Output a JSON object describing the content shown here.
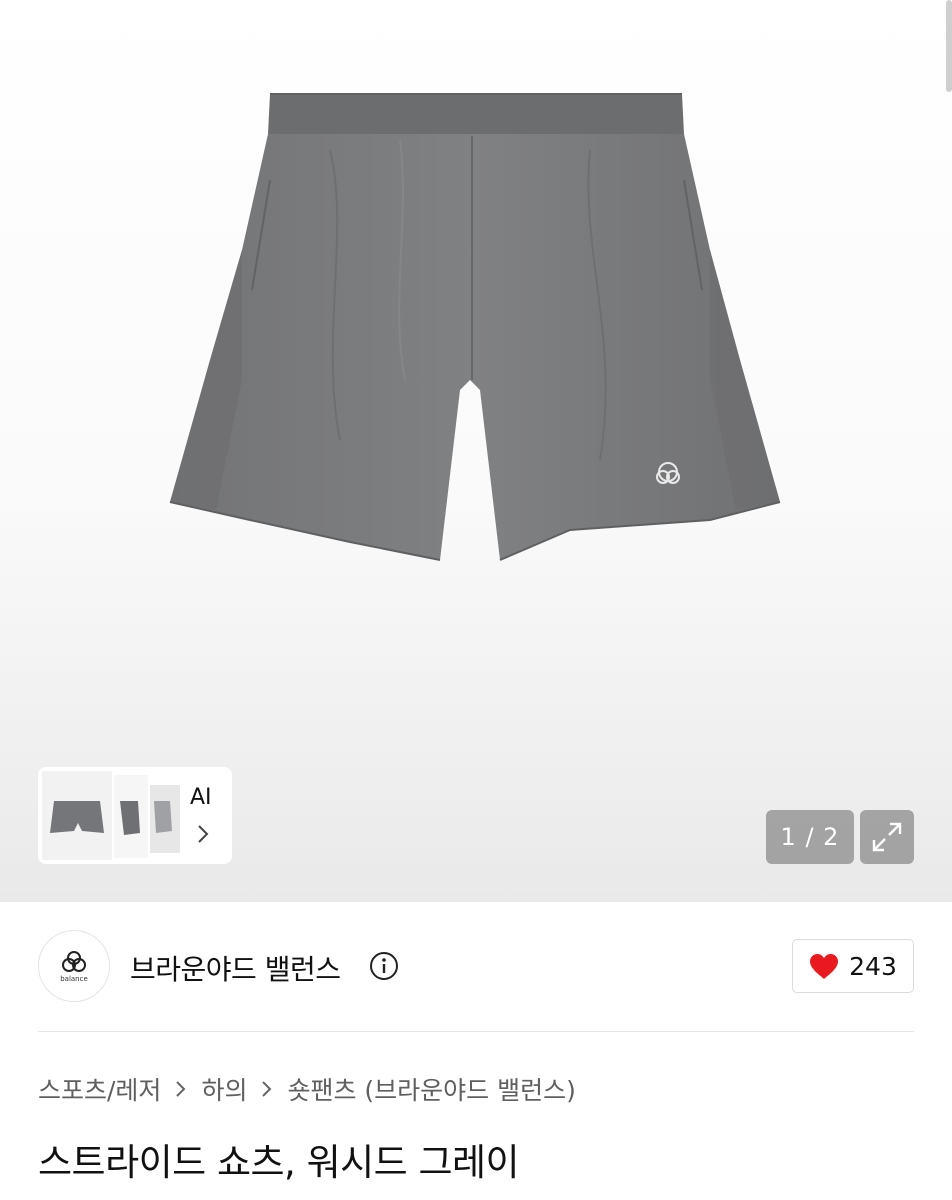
{
  "gallery": {
    "thumbnail_label": "AI",
    "counter": "1 / 2"
  },
  "brand": {
    "logo_text": "balance",
    "name": "브라운야드 밸런스"
  },
  "likes": {
    "count": "243",
    "heart_color": "#e8191f"
  },
  "breadcrumb": {
    "items": [
      "스포츠/레저",
      "하의",
      "숏팬츠 (브라운야드 밸런스)"
    ]
  },
  "product": {
    "title": "스트라이드 쇼츠, 워시드 그레이",
    "color": "#7a7b7d"
  }
}
